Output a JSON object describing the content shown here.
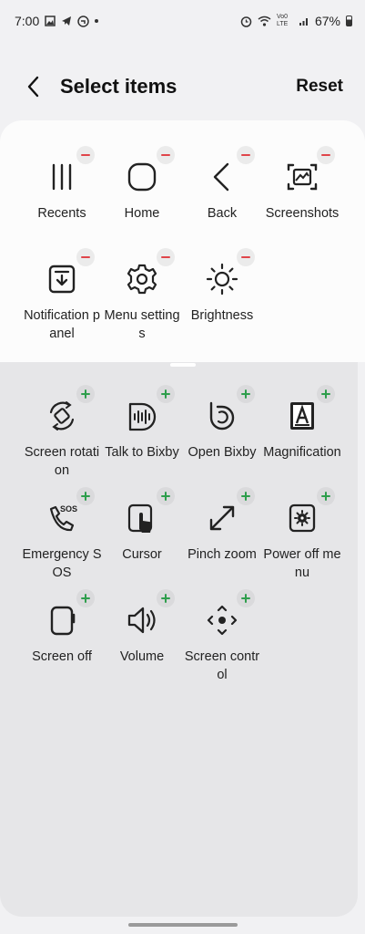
{
  "status_bar": {
    "time": "7:00",
    "battery": "67%",
    "network": "Vo0 LTE"
  },
  "header": {
    "title": "Select items",
    "reset_label": "Reset"
  },
  "selected_items": [
    {
      "label": "Recents",
      "icon": "recents-icon"
    },
    {
      "label": "Home",
      "icon": "home-icon"
    },
    {
      "label": "Back",
      "icon": "back-icon"
    },
    {
      "label": "Screenshots",
      "icon": "screenshot-icon"
    },
    {
      "label": "Notification panel",
      "icon": "notification-panel-icon"
    },
    {
      "label": "Menu settings",
      "icon": "gear-icon"
    },
    {
      "label": "Brightness",
      "icon": "sun-icon"
    }
  ],
  "available_items": [
    {
      "label": "Screen rotation",
      "icon": "rotation-icon"
    },
    {
      "label": "Talk to Bixby",
      "icon": "bixby-voice-icon"
    },
    {
      "label": "Open Bixby",
      "icon": "bixby-icon"
    },
    {
      "label": "Magnification",
      "icon": "magnification-icon"
    },
    {
      "label": "Emergency SOS",
      "icon": "sos-phone-icon"
    },
    {
      "label": "Cursor",
      "icon": "cursor-icon"
    },
    {
      "label": "Pinch zoom",
      "icon": "pinch-zoom-icon"
    },
    {
      "label": "Power off menu",
      "icon": "power-menu-icon"
    },
    {
      "label": "Screen off",
      "icon": "screen-off-icon"
    },
    {
      "label": "Volume",
      "icon": "volume-icon"
    },
    {
      "label": "Screen control",
      "icon": "screen-control-icon"
    }
  ],
  "colors": {
    "remove_badge": "#e0454a",
    "add_badge": "#2e9e4c",
    "background": "#f1f1f3"
  }
}
